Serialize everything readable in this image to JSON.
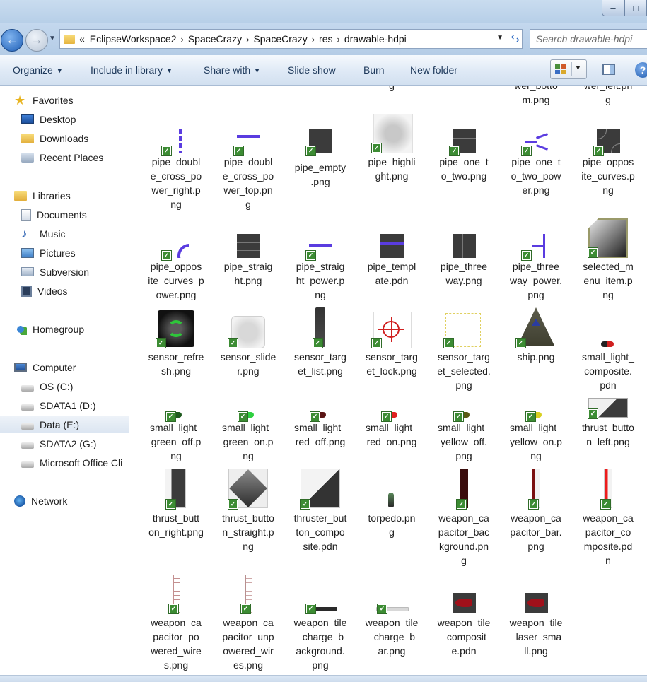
{
  "window": {
    "controls": [
      "–",
      "□"
    ]
  },
  "address": {
    "prefix": "«",
    "crumbs": [
      "EclipseWorkspace2",
      "SpaceCrazy",
      "SpaceCrazy",
      "res",
      "drawable-hdpi"
    ],
    "search_placeholder": "Search drawable-hdpi"
  },
  "toolbar": {
    "organize": "Organize",
    "include": "Include in library",
    "share": "Share with",
    "slideshow": "Slide show",
    "burn": "Burn",
    "newfolder": "New folder",
    "help": "?"
  },
  "nav": {
    "favorites": "Favorites",
    "desktop": "Desktop",
    "downloads": "Downloads",
    "recent": "Recent Places",
    "libraries": "Libraries",
    "documents": "Documents",
    "music": "Music",
    "pictures": "Pictures",
    "subversion": "Subversion",
    "videos": "Videos",
    "homegroup": "Homegroup",
    "computer": "Computer",
    "os": "OS (C:)",
    "sdata1": "SDATA1 (D:)",
    "data": "Data (E:)",
    "sdata2": "SDATA2 (G:)",
    "msoffice": "Microsoft Office Cli",
    "network": "Network"
  },
  "files": {
    "partial_a": "g",
    "partial_b": "wer_botto\nm.png",
    "partial_c": "wer_left.pn\ng",
    "f1": "pipe_doubl\ne_cross_po\nwer_right.p\nng",
    "f2": "pipe_doubl\ne_cross_po\nwer_top.pn\ng",
    "f3": "pipe_empty\n.png",
    "f4": "pipe_highli\nght.png",
    "f5": "pipe_one_t\no_two.png",
    "f6": "pipe_one_t\no_two_pow\ner.png",
    "f7": "pipe_oppos\nite_curves.p\nng",
    "f8": "pipe_oppos\nite_curves_p\nower.png",
    "f9": "pipe_straig\nht.png",
    "f10": "pipe_straig\nht_power.p\nng",
    "f11": "pipe_templ\nate.pdn",
    "f12": "pipe_three\nway.png",
    "f13": "pipe_three\nway_power.\npng",
    "f14": "selected_m\nenu_item.p\nng",
    "f15": "sensor_refre\nsh.png",
    "f16": "sensor_slide\nr.png",
    "f17": "sensor_targ\net_list.png",
    "f18": "sensor_targ\net_lock.png",
    "f19": "sensor_targ\net_selected.\npng",
    "f20": "ship.png",
    "f21": "small_light_\ncomposite.\npdn",
    "f22": "small_light_\ngreen_off.p\nng",
    "f23": "small_light_\ngreen_on.p\nng",
    "f24": "small_light_\nred_off.png",
    "f25": "small_light_\nred_on.png",
    "f26": "small_light_\nyellow_off.\npng",
    "f27": "small_light_\nyellow_on.p\nng",
    "f28": "thrust_butto\nn_left.png",
    "f29": "thrust_butt\non_right.png",
    "f30": "thrust_butto\nn_straight.p\nng",
    "f31": "thruster_but\nton_compo\nsite.pdn",
    "f32": "torpedo.pn\ng",
    "f33": "weapon_ca\npacitor_bac\nkground.pn\ng",
    "f34": "weapon_ca\npacitor_bar.\npng",
    "f35": "weapon_ca\npacitor_co\nmposite.pd\nn",
    "f36": "weapon_ca\npacitor_po\nwered_wire\ns.png",
    "f37": "weapon_ca\npacitor_unp\nowered_wir\nes.png",
    "f38": "weapon_tile\n_charge_b\nackground.\npng",
    "f39": "weapon_tile\n_charge_b\nar.png",
    "f40": "weapon_tile\n_composit\ne.pdn",
    "f41": "weapon_tile\n_laser_sma\nll.png"
  },
  "colors": {
    "check": "#3c8c33",
    "power": "#5a3ce0",
    "tile_dark": "#3b3b3b"
  }
}
